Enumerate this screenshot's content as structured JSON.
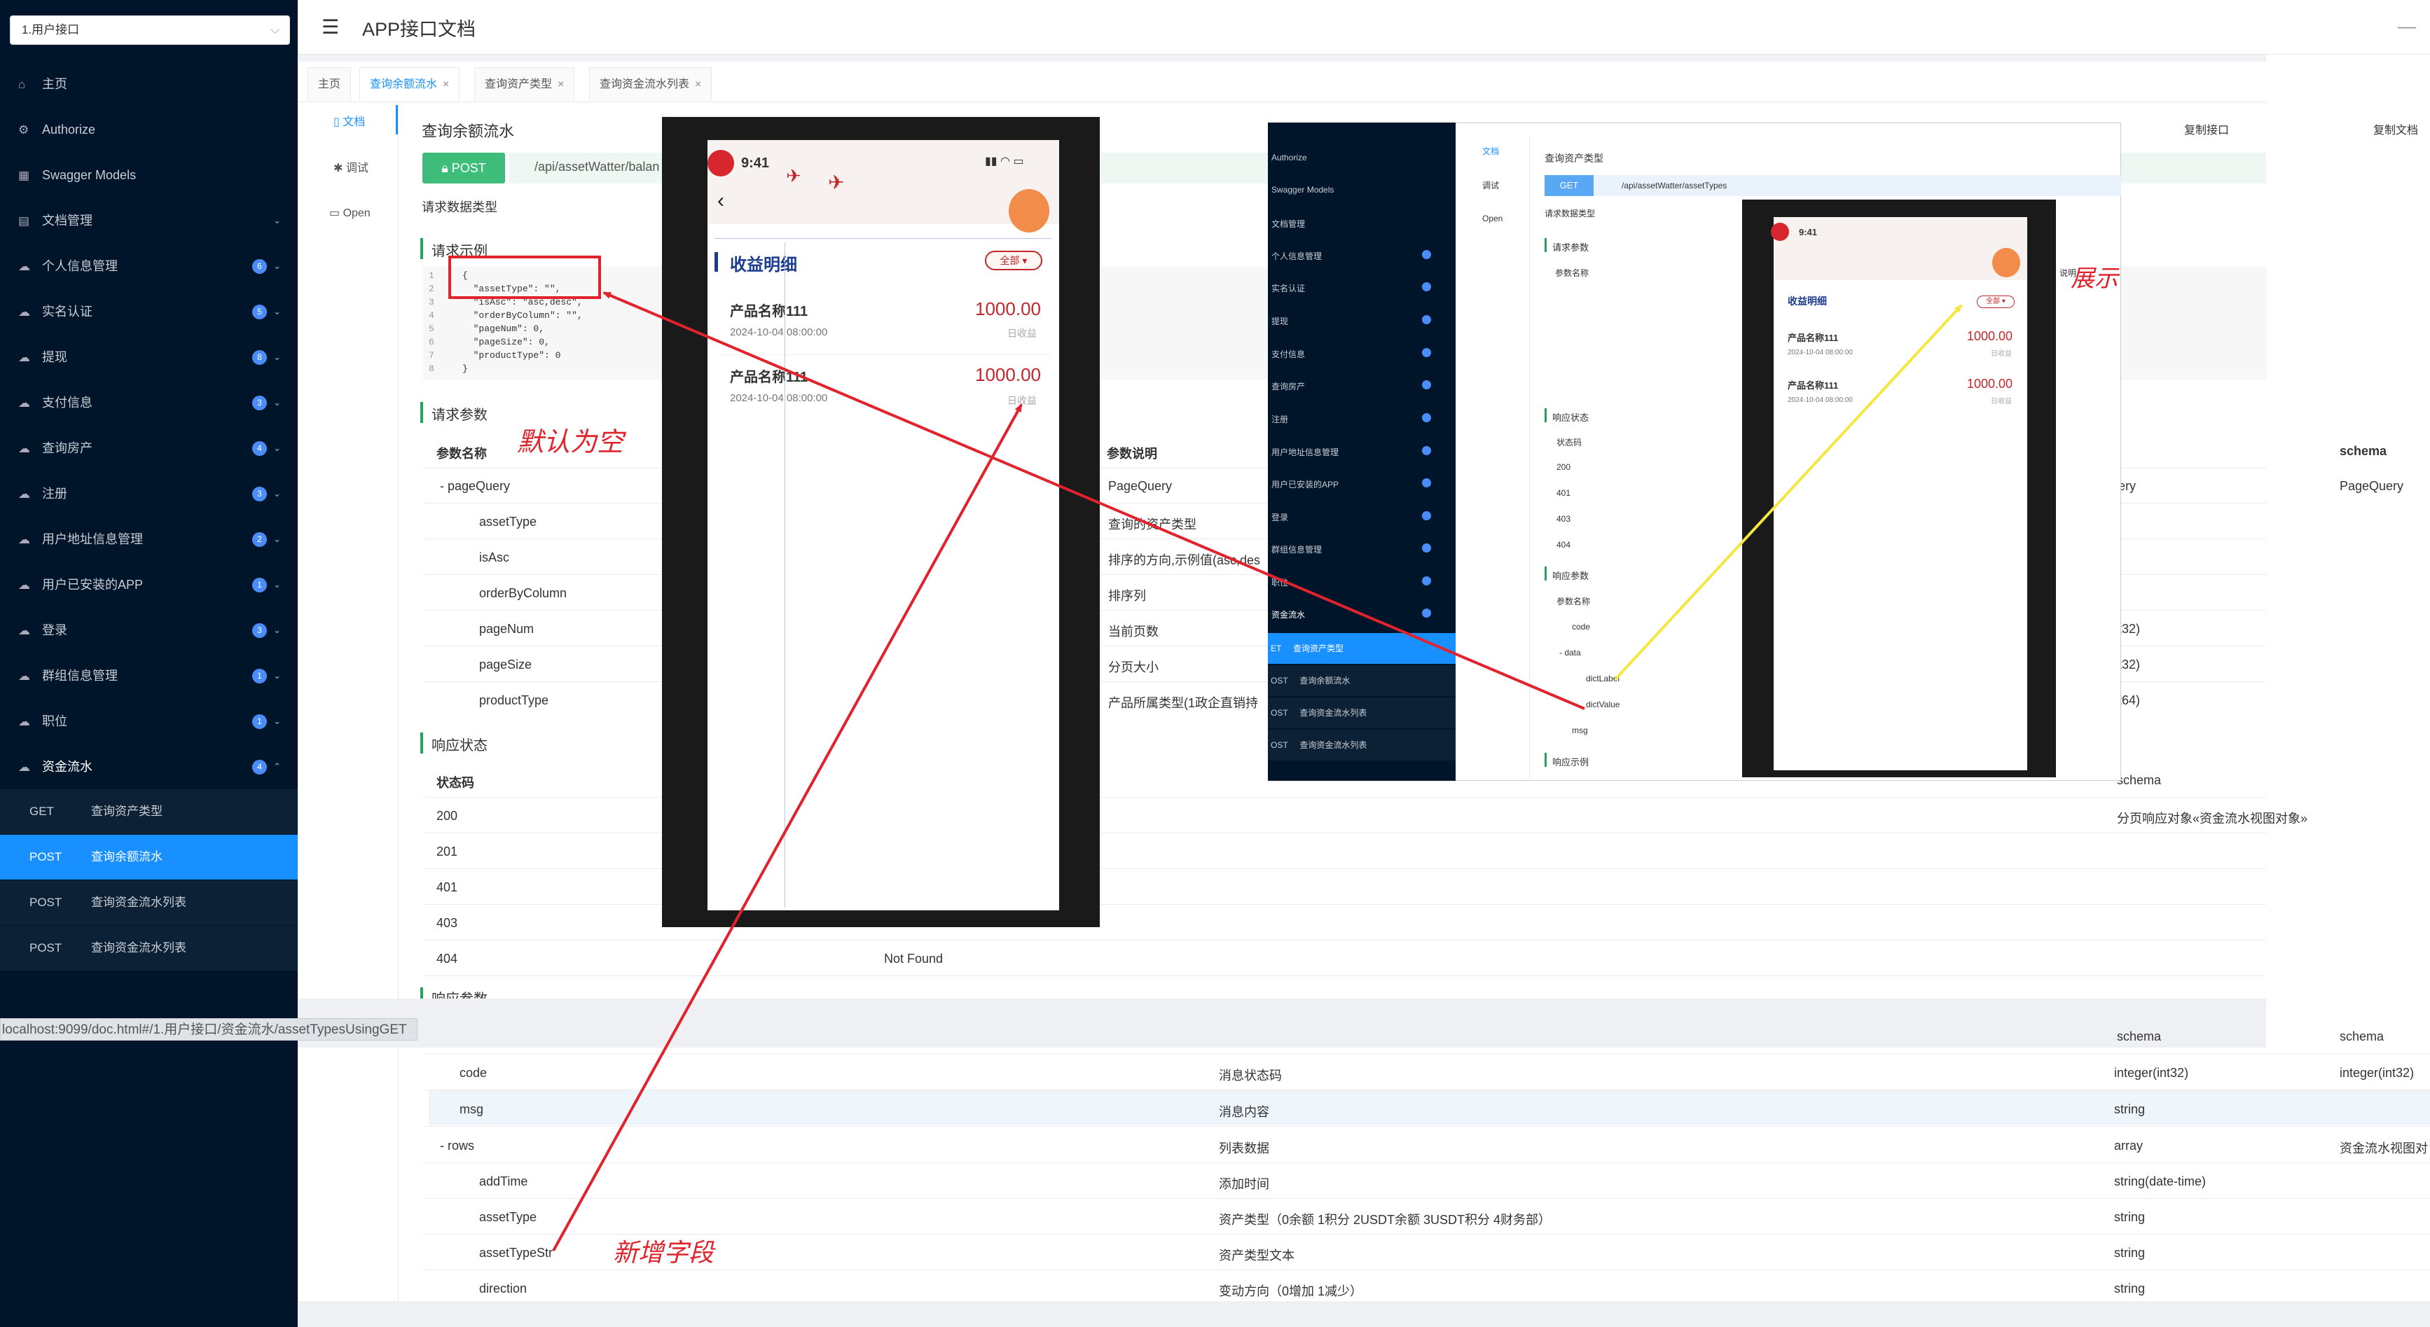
{
  "sidebar": {
    "group_select": "1.用户接口",
    "items": [
      {
        "label": "主页",
        "badge": ""
      },
      {
        "label": "Authorize",
        "badge": ""
      },
      {
        "label": "Swagger Models",
        "badge": ""
      },
      {
        "label": "文档管理",
        "badge": ""
      },
      {
        "label": "个人信息管理",
        "badge": "6"
      },
      {
        "label": "实名认证",
        "badge": "5"
      },
      {
        "label": "提现",
        "badge": "8"
      },
      {
        "label": "支付信息",
        "badge": "3"
      },
      {
        "label": "查询房产",
        "badge": "4"
      },
      {
        "label": "注册",
        "badge": "3"
      },
      {
        "label": "用户地址信息管理",
        "badge": "2"
      },
      {
        "label": "用户已安装的APP",
        "badge": "1"
      },
      {
        "label": "登录",
        "badge": "3"
      },
      {
        "label": "群组信息管理",
        "badge": "1"
      },
      {
        "label": "职位",
        "badge": "1"
      },
      {
        "label": "资金流水",
        "badge": "4"
      }
    ],
    "sub_items": [
      {
        "method": "GET",
        "label": "查询资产类型"
      },
      {
        "method": "POST",
        "label": "查询余额流水"
      },
      {
        "method": "POST",
        "label": "查询资金流水列表"
      },
      {
        "method": "POST",
        "label": "查询资金流水列表"
      }
    ]
  },
  "header": {
    "title": "APP接口文档",
    "right_text": "—"
  },
  "tabs": [
    {
      "label": "主页"
    },
    {
      "label": "查询余额流水"
    },
    {
      "label": "查询资产类型"
    },
    {
      "label": "查询资金流水列表"
    }
  ],
  "doc_tabs": {
    "doc": "文档",
    "debug": "调试",
    "open": "Open"
  },
  "api": {
    "title": "查询余额流水",
    "method": "POST",
    "url": "/api/assetWatter/balan",
    "request_data_type": "请求数据类型",
    "copy_interface": "复制接口",
    "copy_doc": "复制文档"
  },
  "request_example": {
    "title": "请求示例",
    "lines": [
      "{",
      "  \"assetType\": \"\",",
      "  \"isAsc\": \"asc,desc\",",
      "  \"orderByColumn\": \"\",",
      "  \"pageNum\": 0,",
      "  \"pageSize\": 0,",
      "  \"productType\": 0",
      "}"
    ]
  },
  "request_params": {
    "title": "请求参数",
    "headers": {
      "name": "参数名称",
      "desc": "参数说明",
      "schema": "schema"
    },
    "rows": [
      {
        "name": "- pageQuery",
        "desc": "PageQuery",
        "type": "ery",
        "schema": "PageQuery"
      },
      {
        "name": "assetType",
        "desc": "查询的资产类型",
        "type": "",
        "schema": ""
      },
      {
        "name": "isAsc",
        "desc": "排序的方向,示例值(asc,des",
        "type": "",
        "schema": ""
      },
      {
        "name": "orderByColumn",
        "desc": "排序列",
        "type": "",
        "schema": ""
      },
      {
        "name": "pageNum",
        "desc": "当前页数",
        "type": "t32)",
        "schema": ""
      },
      {
        "name": "pageSize",
        "desc": "分页大小",
        "type": "t32)",
        "schema": ""
      },
      {
        "name": "productType",
        "desc": "产品所属类型(1政企直销持",
        "type": "t64)",
        "schema": ""
      }
    ]
  },
  "response_status": {
    "title": "响应状态",
    "headers": {
      "code": "状态码",
      "schema": "schema"
    },
    "rows": [
      {
        "code": "200",
        "desc": "",
        "schema": "分页响应对象«资金流水视图对象»"
      },
      {
        "code": "201",
        "desc": "",
        "schema": ""
      },
      {
        "code": "401",
        "desc": "",
        "schema": ""
      },
      {
        "code": "403",
        "desc": "",
        "schema": ""
      },
      {
        "code": "404",
        "desc": "Not Found",
        "schema": ""
      }
    ]
  },
  "response_params": {
    "title_partial": "响应参数",
    "schema_header": "schema",
    "rows": [
      {
        "name": "code",
        "desc": "消息状态码",
        "type": "integer(int32)",
        "schema": "integer(int32)"
      },
      {
        "name": "msg",
        "desc": "消息内容",
        "type": "string",
        "schema": ""
      },
      {
        "name": "- rows",
        "desc": "列表数据",
        "type": "array",
        "schema": "资金流水视图对"
      },
      {
        "name": "addTime",
        "desc": "添加时间",
        "type": "string(date-time)",
        "schema": ""
      },
      {
        "name": "assetType",
        "desc": "资产类型（0余额 1积分 2USDT余额 3USDT积分 4财务部）",
        "type": "string",
        "schema": ""
      },
      {
        "name": "assetTypeStr",
        "desc": "资产类型文本",
        "type": "string",
        "schema": ""
      },
      {
        "name": "direction",
        "desc": "变动方向（0增加 1减少）",
        "type": "string",
        "schema": ""
      }
    ]
  },
  "phone": {
    "time": "9:41",
    "title": "收益明细",
    "filter": "全部 ▾",
    "items": [
      {
        "name": "产品名称111",
        "amount": "1000.00",
        "date": "2024-10-04 08:00:00",
        "label": "日收益"
      },
      {
        "name": "产品名称111",
        "amount": "1000.00",
        "date": "2024-10-04 08:00:00",
        "label": "日收益"
      }
    ]
  },
  "embedded": {
    "sidebar_items": [
      {
        "label": "Authorize"
      },
      {
        "label": "Swagger Models"
      },
      {
        "label": "文档管理"
      },
      {
        "label": "个人信息管理"
      },
      {
        "label": "实名认证"
      },
      {
        "label": "提现"
      },
      {
        "label": "支付信息"
      },
      {
        "label": "查询房产"
      },
      {
        "label": "注册"
      },
      {
        "label": "用户地址信息管理"
      },
      {
        "label": "用户已安装的APP"
      },
      {
        "label": "登录"
      },
      {
        "label": "群组信息管理"
      },
      {
        "label": "职位"
      },
      {
        "label": "资金流水"
      }
    ],
    "sub_items": [
      {
        "method": "ET",
        "label": "查询资产类型"
      },
      {
        "method": "OST",
        "label": "查询余额流水"
      },
      {
        "method": "OST",
        "label": "查询资金流水列表"
      },
      {
        "method": "OST",
        "label": "查询资金流水列表"
      }
    ],
    "doc_tabs": {
      "doc": "文档",
      "debug": "调试",
      "open": "Open"
    },
    "title": "查询资产类型",
    "method": "GET",
    "url": "/api/assetWatter/assetTypes",
    "request_data_type": "请求数据类型",
    "request_params": "请求参数",
    "param_name": "参数名称",
    "explain": "说明",
    "response_status": "响应状态",
    "status_codes": [
      "状态码",
      "200",
      "401",
      "403",
      "404"
    ],
    "response_params": "响应参数",
    "resp_rows": [
      "参数名称",
      "code",
      "- data",
      "dictLabel",
      "dictValue",
      "msg"
    ],
    "response_example": "响应示例",
    "phone": {
      "time": "9:41",
      "title": "收益明细",
      "filter": "全部 ▾",
      "items": [
        {
          "name": "产品名称111",
          "amount": "1000.00",
          "date": "2024-10-04 08:00:00",
          "label": "日收益"
        },
        {
          "name": "产品名称111",
          "amount": "1000.00",
          "date": "2024-10-04 08:00:00",
          "label": "日收益"
        }
      ]
    }
  },
  "annotations": {
    "default_empty": "默认为空",
    "new_field": "新增字段",
    "display": "展示"
  },
  "status_url": "localhost:9099/doc.html#/1.用户接口/资金流水/assetTypesUsingGET",
  "colors": {
    "sidebar": "#001529",
    "active": "#1890ff",
    "post": "#3ebd7a",
    "annotation": "#e0232d",
    "yellow_arrow": "#f5e642"
  }
}
